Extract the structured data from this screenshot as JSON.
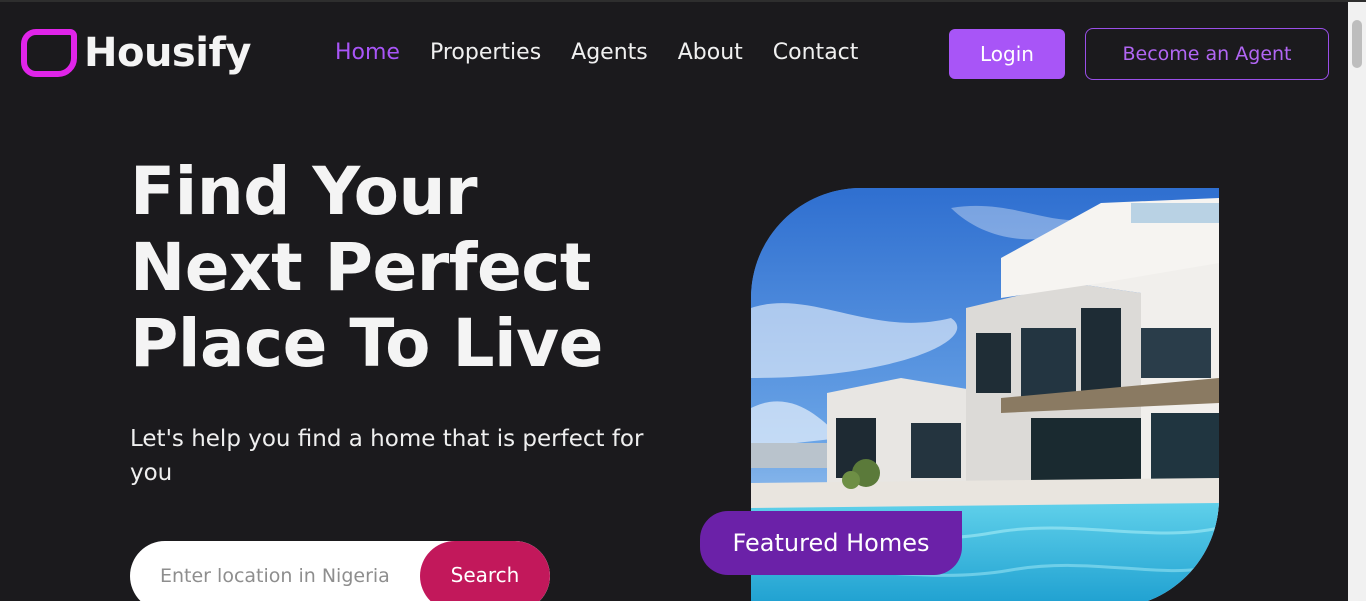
{
  "brand": {
    "name": "Housify",
    "accent_color": "#e024e9",
    "logo_icon": "rounded-square-logo-icon"
  },
  "nav": {
    "items": [
      {
        "label": "Home",
        "active": true
      },
      {
        "label": "Properties",
        "active": false
      },
      {
        "label": "Agents",
        "active": false
      },
      {
        "label": "About",
        "active": false
      },
      {
        "label": "Contact",
        "active": false
      }
    ]
  },
  "actions": {
    "login_label": "Login",
    "agent_label": "Become an Agent"
  },
  "hero": {
    "title_lines": [
      "Find Your",
      "Next Perfect",
      "Place To Live"
    ],
    "subtitle": "Let's help you find a home that is perfect for you",
    "search_placeholder": "Enter location in Nigeria",
    "search_button": "Search",
    "featured_label": "Featured Homes"
  },
  "colors": {
    "background": "#1b1a1d",
    "primary_purple": "#a855f7",
    "featured_purple": "#6b21a8",
    "search_pink": "#c2185b"
  }
}
